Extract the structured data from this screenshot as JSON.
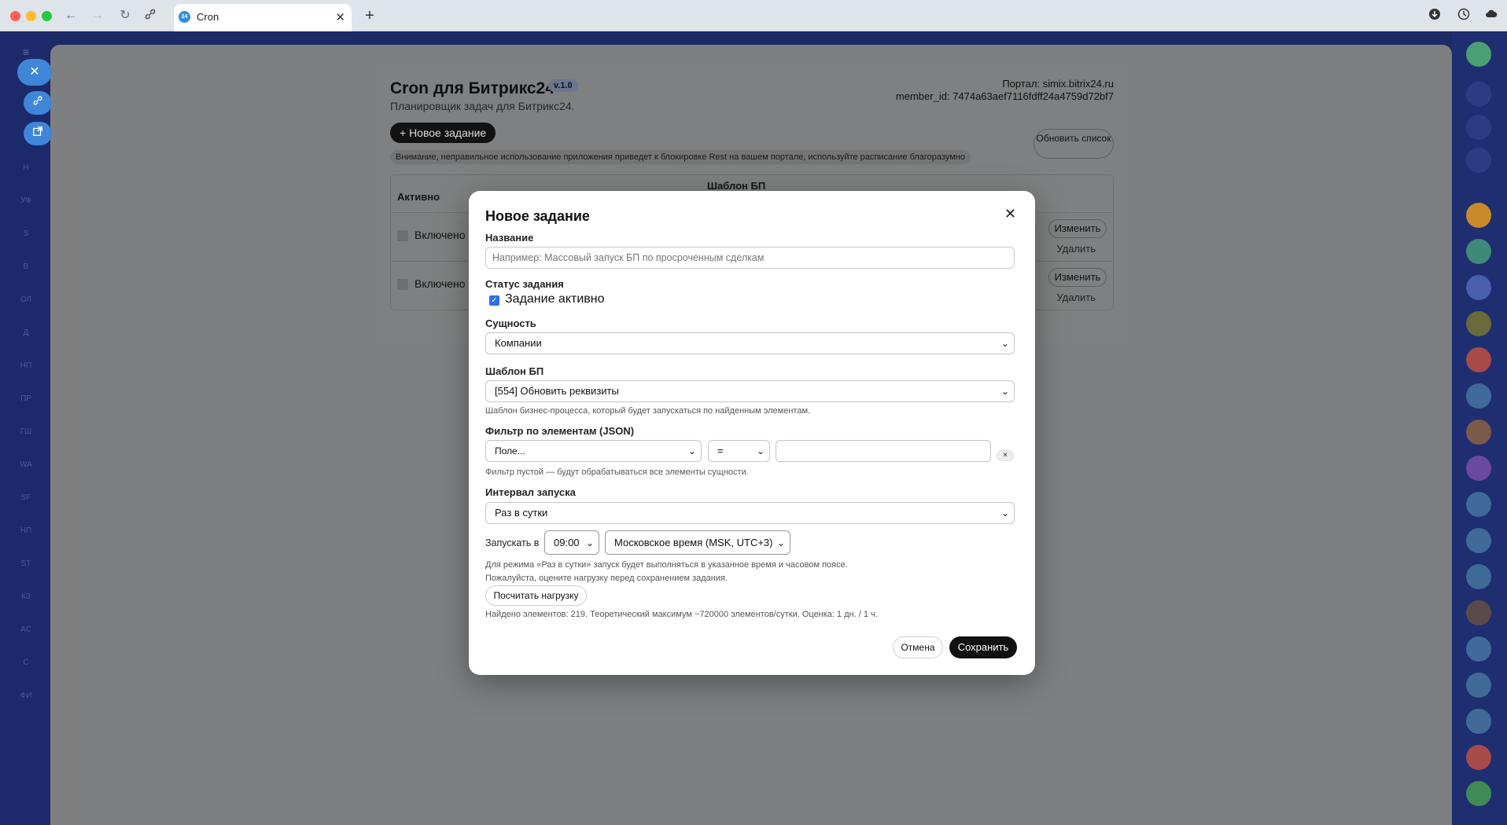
{
  "browser": {
    "tab_title": "Cron",
    "tab_favicon": "24",
    "close_tab": "✕",
    "new_tab": "+"
  },
  "left_rail": {
    "items": [
      "Н",
      "УФ",
      "S",
      "В",
      "ОЛ",
      "Д",
      "НП",
      "ПР",
      "ГШ",
      "WA",
      "SF",
      "НП",
      "ST",
      "КЗ",
      "AC",
      "С",
      "ФИ"
    ]
  },
  "app": {
    "title": "Cron для Битрикс24",
    "version": "v.1.0",
    "subtitle": "Планировщик задач для Битрикс24.",
    "portal_line": "Портал: simix.bitrix24.ru",
    "member_line": "member_id: 7474a63aef7116fdff24a4759d72bf7",
    "new_task_button": "+ Новое задание",
    "warning": "Внимание, неправильное использование приложения приведет к блокировке Rest на вашем портале, используйте расписание благоразумно",
    "refresh_button": "Обновить список",
    "table": {
      "col_active": "Активно",
      "col_template": "Шаблон БП",
      "rows": [
        {
          "status": "Включено",
          "edit": "Изменить",
          "delete": "Удалить"
        },
        {
          "status": "Включено",
          "edit": "Изменить",
          "delete": "Удалить"
        }
      ]
    }
  },
  "modal": {
    "title": "Новое задание",
    "close": "✕",
    "name_label": "Название",
    "name_placeholder": "Например: Массовый запуск БП по просроченным сделкам",
    "status_label": "Статус задания",
    "status_checkbox": "Задание активно",
    "status_checked": true,
    "entity_label": "Сущность",
    "entity_value": "Компании",
    "template_label": "Шаблон БП",
    "template_value": "[554] Обновить реквизиты",
    "template_hint": "Шаблон бизнес-процесса, который будет запускаться по найденным элементам.",
    "filter_label": "Фильтр по элементам (JSON)",
    "filter_field": "Поле...",
    "filter_op": "=",
    "filter_value": "",
    "filter_remove": "×",
    "filter_hint": "Фильтр пустой — будут обрабатываться все элементы сущности.",
    "interval_label": "Интервал запуска",
    "interval_value": "Раз в сутки",
    "run_at_label": "Запускать в",
    "run_at_time": "09:00",
    "timezone": "Московское время (MSK, UTC+3)",
    "run_hint_1": "Для режима «Раз в сутки» запуск будет выполняться в указанное время и часовом поясе.",
    "run_hint_2": "Пожалуйста, оцените нагрузку перед сохранением задания.",
    "calc_button": "Посчитать нагрузку",
    "calc_result": "Найдено элементов: 219. Теоретический максимум ~720000 элементов/сутки. Оценка: 1 дн. / 1 ч.",
    "cancel_button": "Отмена",
    "save_button": "Сохранить"
  }
}
